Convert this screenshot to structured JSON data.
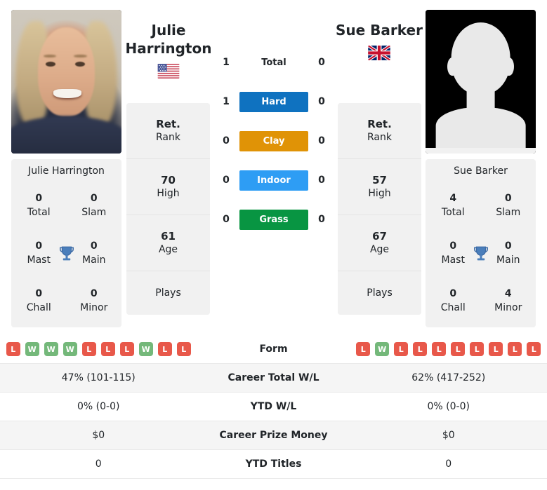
{
  "players": {
    "left": {
      "name": "Julie Harrington",
      "name_lines": [
        "Julie",
        "Harrington"
      ],
      "flag": "us-flag-icon",
      "photo": "player-photo",
      "rank": {
        "value": "Ret.",
        "key": "Rank"
      },
      "high": {
        "value": "70",
        "key": "High"
      },
      "age": {
        "value": "61",
        "key": "Age"
      },
      "plays": {
        "value": "",
        "key": "Plays"
      },
      "titles": {
        "total": {
          "value": "0",
          "key": "Total"
        },
        "slam": {
          "value": "0",
          "key": "Slam"
        },
        "mast": {
          "value": "0",
          "key": "Mast"
        },
        "main": {
          "value": "0",
          "key": "Main"
        },
        "chall": {
          "value": "0",
          "key": "Chall"
        },
        "minor": {
          "value": "0",
          "key": "Minor"
        }
      },
      "surface_scores": {
        "total": "1",
        "hard": "1",
        "clay": "0",
        "indoor": "0",
        "grass": "0"
      },
      "form": [
        "L",
        "W",
        "W",
        "W",
        "L",
        "L",
        "L",
        "W",
        "L",
        "L"
      ],
      "career_wl": "47% (101-115)",
      "ytd_wl": "0% (0-0)",
      "career_prize_money": "$0",
      "ytd_titles": "0"
    },
    "right": {
      "name": "Sue Barker",
      "name_lines": [
        "Sue Barker"
      ],
      "flag": "uk-flag-icon",
      "photo": "player-photo-placeholder",
      "rank": {
        "value": "Ret.",
        "key": "Rank"
      },
      "high": {
        "value": "57",
        "key": "High"
      },
      "age": {
        "value": "67",
        "key": "Age"
      },
      "plays": {
        "value": "",
        "key": "Plays"
      },
      "titles": {
        "total": {
          "value": "4",
          "key": "Total"
        },
        "slam": {
          "value": "0",
          "key": "Slam"
        },
        "mast": {
          "value": "0",
          "key": "Mast"
        },
        "main": {
          "value": "0",
          "key": "Main"
        },
        "chall": {
          "value": "0",
          "key": "Chall"
        },
        "minor": {
          "value": "4",
          "key": "Minor"
        }
      },
      "surface_scores": {
        "total": "0",
        "hard": "0",
        "clay": "0",
        "indoor": "0",
        "grass": "0"
      },
      "form": [
        "L",
        "W",
        "L",
        "L",
        "L",
        "L",
        "L",
        "L",
        "L",
        "L"
      ],
      "career_wl": "62% (417-252)",
      "ytd_wl": "0% (0-0)",
      "career_prize_money": "$0",
      "ytd_titles": "0"
    }
  },
  "surfaces": [
    {
      "key": "total",
      "label": "Total",
      "color": "transparent",
      "plain": true
    },
    {
      "key": "hard",
      "label": "Hard",
      "color": "#0f72c0",
      "plain": false
    },
    {
      "key": "clay",
      "label": "Clay",
      "color": "#e09306",
      "plain": false
    },
    {
      "key": "indoor",
      "label": "Indoor",
      "color": "#2e9df4",
      "plain": false
    },
    {
      "key": "grass",
      "label": "Grass",
      "color": "#089542",
      "plain": false
    }
  ],
  "stats_rows": [
    {
      "key": "form",
      "label": "Form",
      "type": "form",
      "shaded": false
    },
    {
      "key": "career_wl",
      "label": "Career Total W/L",
      "type": "text",
      "shaded": true
    },
    {
      "key": "ytd_wl",
      "label": "YTD W/L",
      "type": "text",
      "shaded": false
    },
    {
      "key": "career_prize_money",
      "label": "Career Prize Money",
      "type": "text",
      "shaded": true
    },
    {
      "key": "ytd_titles",
      "label": "YTD Titles",
      "type": "text",
      "shaded": false
    }
  ],
  "colors": {
    "win_badge": "#e8584a",
    "loss_badge": "#e8584a",
    "win_green": "#74b87a",
    "card_bg": "#f1f1f1",
    "row_shade": "#f5f5f5"
  }
}
